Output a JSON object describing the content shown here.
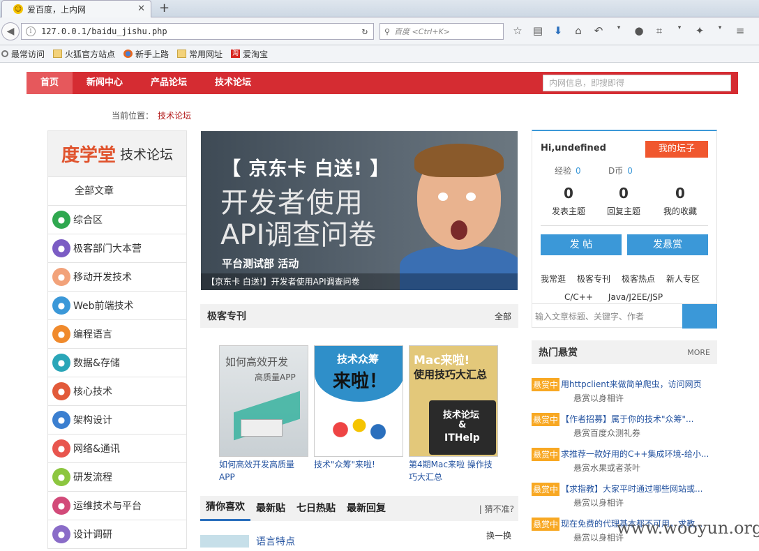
{
  "browser": {
    "tab_title": "爱百度，上内网",
    "url": "127.0.0.1/baidu_jishu.php",
    "search_placeholder": "百度 <Ctrl+K>",
    "bookmarks": [
      "最常访问",
      "火狐官方站点",
      "新手上路",
      "常用网址",
      "爱淘宝"
    ]
  },
  "topnav": {
    "items": [
      "首页",
      "新闻中心",
      "产品论坛",
      "技术论坛"
    ],
    "search_placeholder": "内网信息，即搜即得"
  },
  "breadcrumb": {
    "label": "当前位置：",
    "current": "技术论坛"
  },
  "sidebar": {
    "logo_a": "度学堂",
    "logo_b": "技术论坛",
    "all": "全部文章",
    "items": [
      {
        "label": "综合区",
        "color": "#2fa84f"
      },
      {
        "label": "极客部门大本营",
        "color": "#7b5cc4"
      },
      {
        "label": "移动开发技术",
        "color": "#f2a27a"
      },
      {
        "label": "Web前端技术",
        "color": "#3b98d8"
      },
      {
        "label": "编程语言",
        "color": "#f08a2c"
      },
      {
        "label": "数据&存储",
        "color": "#2aa6b8"
      },
      {
        "label": "核心技术",
        "color": "#e25a3a"
      },
      {
        "label": "架构设计",
        "color": "#3b7fd0"
      },
      {
        "label": "网络&通讯",
        "color": "#e8554e"
      },
      {
        "label": "研发流程",
        "color": "#8cc63f"
      },
      {
        "label": "运维技术与平台",
        "color": "#d24a79"
      },
      {
        "label": "设计调研",
        "color": "#8a6cc8"
      }
    ]
  },
  "banner": {
    "t1": "【 京东卡 白送! 】",
    "t2": "开发者使用",
    "t3": "API调查问卷",
    "t4": "平台测试部 活动",
    "caption": "【京东卡 白送!】开发者使用API调查问卷"
  },
  "geek": {
    "title": "极客专刊",
    "more": "全部",
    "cards": [
      {
        "img_t1": "如何高效开发",
        "img_t2": "高质量APP",
        "caption": "如何高效开发高质量APP"
      },
      {
        "img_t1": "技术众筹",
        "img_t2": "来啦！",
        "caption": "技术\"众筹\"来啦!"
      },
      {
        "img_t1": "Mac来啦!",
        "img_t2": "使用技巧大汇总",
        "img_t3": "技术论坛",
        "img_t4": "&",
        "img_t5": "ITHelp",
        "caption": "第4期Mac来啦 操作技巧大汇总"
      }
    ]
  },
  "tabs": {
    "items": [
      "猜你喜欢",
      "最新贴",
      "七日热贴",
      "最新回复"
    ],
    "right": "| 猜不准?",
    "swap": "换一换",
    "first_item": "语言特点"
  },
  "user": {
    "hi": "Hi,undefined",
    "mine": "我的坛子",
    "exp_label": "经验",
    "exp": "0",
    "coin_label": "D币",
    "coin": "0",
    "stats": [
      {
        "num": "0",
        "label": "发表主题"
      },
      {
        "num": "0",
        "label": "回复主题"
      },
      {
        "num": "0",
        "label": "我的收藏"
      }
    ],
    "post": "发 帖",
    "reward": "发悬赏",
    "links": [
      "我常逛",
      "极客专刊",
      "极客热点",
      "新人专区",
      "C/C++",
      "Java/J2EE/JSP"
    ],
    "search_placeholder": "输入文章标题、关键字、作者"
  },
  "hot": {
    "title": "热门悬赏",
    "more": "MORE",
    "items": [
      {
        "tag": "悬赏中",
        "title": "用httpclient来做简单爬虫，访问网页",
        "sub": "悬赏以身相许"
      },
      {
        "tag": "悬赏中",
        "title": "【作者招募】属于你的技术\"众筹\"...",
        "sub": "悬赏百度众测礼券"
      },
      {
        "tag": "悬赏中",
        "title": "求推荐一款好用的C++集成环境-给小...",
        "sub": "悬赏水果或者茶叶"
      },
      {
        "tag": "悬赏中",
        "title": "【求指教】大家平时通过哪些网站或...",
        "sub": "悬赏以身相许"
      },
      {
        "tag": "悬赏中",
        "title": "现在免费的代理基本都不可用，求教...",
        "sub": "悬赏以身相许"
      }
    ]
  },
  "watermark": "www.wooyun.org"
}
